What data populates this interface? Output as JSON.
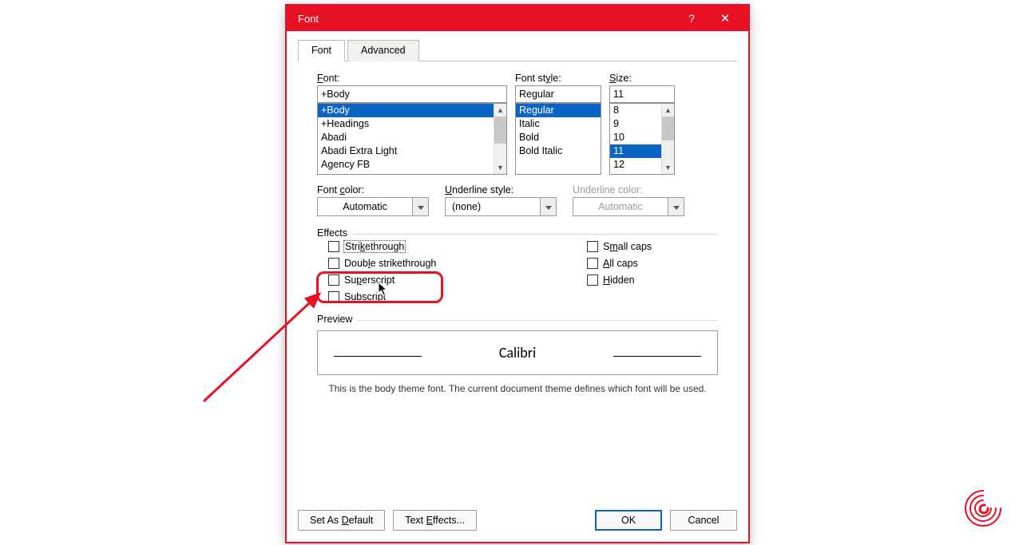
{
  "dialog": {
    "title": "Font",
    "help_icon": "?",
    "close_icon": "✕"
  },
  "tabs": {
    "font": "Font",
    "advanced": "Advanced",
    "active": "font"
  },
  "font": {
    "label": "Font:",
    "value": "+Body",
    "list": [
      "+Body",
      "+Headings",
      "Abadi",
      "Abadi Extra Light",
      "Agency FB"
    ],
    "selected": "+Body"
  },
  "style": {
    "label": "Font style:",
    "value": "Regular",
    "list": [
      "Regular",
      "Italic",
      "Bold",
      "Bold Italic"
    ],
    "selected": "Regular"
  },
  "size": {
    "label": "Size:",
    "value": "11",
    "list": [
      "8",
      "9",
      "10",
      "11",
      "12"
    ],
    "selected": "11"
  },
  "color": {
    "label": "Font color:",
    "value": "Automatic"
  },
  "underline_style": {
    "label": "Underline style:",
    "value": "(none)"
  },
  "underline_color": {
    "label": "Underline color:",
    "value": "Automatic"
  },
  "effects": {
    "section": "Effects",
    "strikethrough": "Strikethrough",
    "double_strikethrough": "Double strikethrough",
    "superscript": "Superscript",
    "subscript": "Subscript",
    "small_caps": "Small caps",
    "all_caps": "All caps",
    "hidden": "Hidden"
  },
  "preview": {
    "section": "Preview",
    "sample": "Calibri",
    "note": "This is the body theme font. The current document theme defines which font will be used."
  },
  "footer": {
    "set_default": "Set As Default",
    "text_effects": "Text Effects...",
    "ok": "OK",
    "cancel": "Cancel"
  }
}
